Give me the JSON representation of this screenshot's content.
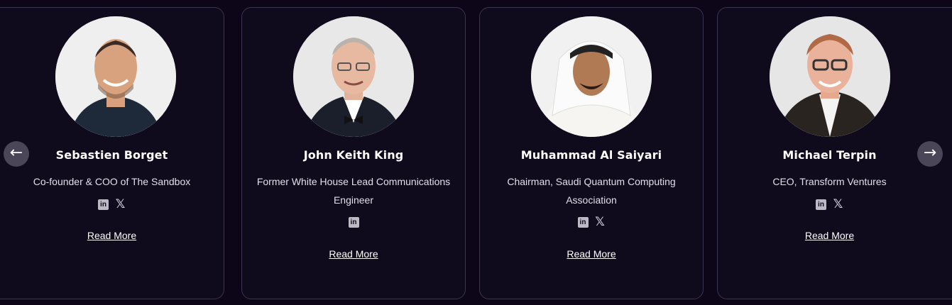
{
  "speakers": [
    {
      "name": "Sebastien Borget",
      "role": "Co-founder & COO of The Sandbox",
      "socials": [
        "linkedin-icon",
        "x-icon"
      ],
      "read_more": "Read More"
    },
    {
      "name": "John Keith King",
      "role": "Former White House Lead Communications Engineer",
      "socials": [
        "linkedin-icon"
      ],
      "read_more": "Read More"
    },
    {
      "name": "Muhammad Al Saiyari",
      "role": "Chairman, Saudi Quantum Computing Association",
      "socials": [
        "linkedin-icon",
        "x-icon"
      ],
      "read_more": "Read More"
    },
    {
      "name": "Michael Terpin",
      "role": "CEO, Transform Ventures",
      "socials": [
        "linkedin-icon",
        "x-icon"
      ],
      "read_more": "Read More"
    }
  ],
  "nav": {
    "prev_icon": "arrow-left-icon",
    "next_icon": "arrow-right-icon",
    "prev_glyph": "←",
    "next_glyph": "→"
  },
  "icons": {
    "linkedin_glyph": "in",
    "x_glyph": "𝕏"
  },
  "colors": {
    "background": "#0d0618",
    "card_border": "#3a3450",
    "arrow_bg": "#4a4557"
  }
}
